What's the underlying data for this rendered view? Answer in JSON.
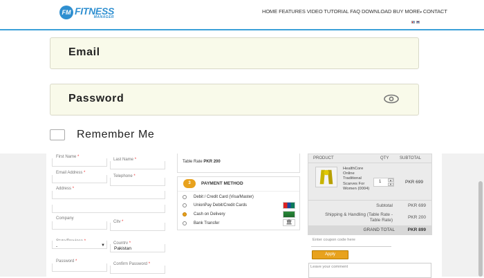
{
  "header": {
    "logo_badge": "FM",
    "logo_main": "FITNESS",
    "logo_sub": "MANAGER",
    "nav": [
      "HOME",
      "FEATURES",
      "VIDEO TUTORIAL",
      "FAQ",
      "DOWNLOAD",
      "BUY",
      "MORE",
      "CONTACT"
    ],
    "accent_color": "#3aa0d8"
  },
  "login": {
    "email_label": "Email",
    "password_label": "Password",
    "remember_label": "Remember Me",
    "field_bg": "#f9faea"
  },
  "billing": {
    "first_name": "First Name",
    "last_name": "Last Name",
    "email": "Email Address",
    "phone": "Telephone",
    "address": "Address",
    "company": "Company",
    "city": "City",
    "state": "State/Province",
    "state_value": "-",
    "country": "Country",
    "country_value": "Pakistan",
    "password": "Password",
    "confirm_password": "Confirm Password"
  },
  "shipping": {
    "rate_text": "Table Rate",
    "rate_price": "PKR 200"
  },
  "payment": {
    "step": "3",
    "title": "PAYMENT METHOD",
    "methods": [
      {
        "label": "Debit / Credit Card (Visa/Master)",
        "selected": false
      },
      {
        "label": "UnionPay Debit/Credit Cards",
        "selected": false
      },
      {
        "label": "Cash on Delivery",
        "selected": true
      },
      {
        "label": "Bank Transfer",
        "selected": false
      }
    ]
  },
  "cart": {
    "headers": {
      "product": "PRODUCT",
      "qty": "QTY",
      "subtotal": "SUBTOTAL"
    },
    "item": {
      "name": "HealthCore Online Traditional Scarves For Women (0004)",
      "qty": "1",
      "price": "PKR 699"
    },
    "subtotal_label": "Subtotal",
    "subtotal_value": "PKR 699",
    "shipping_label": "Shipping & Handling (Table Rate - Table Rate)",
    "shipping_value": "PKR 200",
    "grand_label": "GRAND TOTAL",
    "grand_value": "PKR 899"
  },
  "coupon": {
    "label": "Enter coupon code here",
    "apply_label": "Apply"
  },
  "comment": {
    "placeholder": "Leave your comment"
  },
  "colors": {
    "button_orange": "#e8a21d",
    "brand_blue": "#2f8fd0"
  }
}
